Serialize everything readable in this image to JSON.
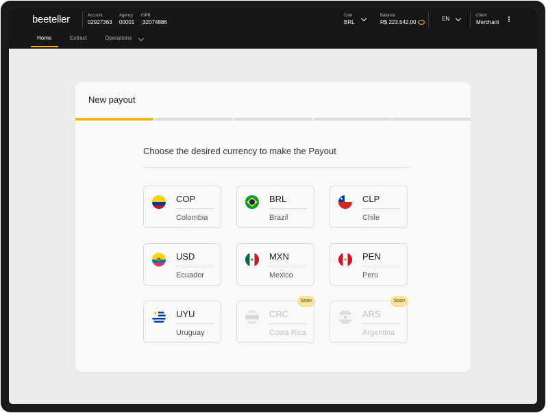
{
  "header": {
    "logo": "beeteller",
    "account": {
      "label": "Account",
      "value": "02927363"
    },
    "agency": {
      "label": "Agency",
      "value": "00001"
    },
    "ispb": {
      "label": "ISPB",
      "value": ";32074886"
    },
    "coin": {
      "label": "Coin",
      "value": "BRL"
    },
    "balance": {
      "label": "Balance",
      "value": "R$ 223.542,00"
    },
    "language": "EN",
    "client": {
      "label": "Client",
      "value": "Merchant"
    }
  },
  "nav": {
    "home": "Home",
    "extract": "Extract",
    "operations": "Operations"
  },
  "card": {
    "title": "New payout",
    "instruction": "Choose the desired currency to make the Payout",
    "soon_label": "Soon"
  },
  "currencies": [
    {
      "code": "COP",
      "country": "Colombia",
      "flag": "colombia-flag"
    },
    {
      "code": "BRL",
      "country": "Brazil",
      "flag": "brazil-flag"
    },
    {
      "code": "CLP",
      "country": "Chile",
      "flag": "chile-flag"
    },
    {
      "code": "USD",
      "country": "Ecuador",
      "flag": "ecuador-flag"
    },
    {
      "code": "MXN",
      "country": "Mexico",
      "flag": "mexico-flag"
    },
    {
      "code": "PEN",
      "country": "Peru",
      "flag": "peru-flag"
    },
    {
      "code": "UYU",
      "country": "Uruguay",
      "flag": "uruguay-flag"
    },
    {
      "code": "CRC",
      "country": "Costa Rica",
      "flag": "costa-rica-flag"
    },
    {
      "code": "ARS",
      "country": "Argentina",
      "flag": "argentina-flag"
    }
  ],
  "colors": {
    "accent": "#f2b705",
    "topbar": "#161616",
    "background": "#ececec"
  }
}
